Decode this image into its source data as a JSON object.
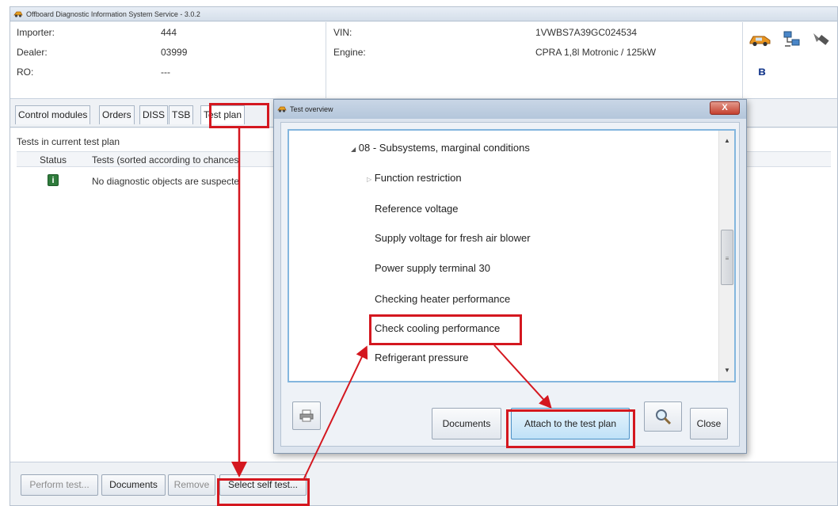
{
  "window": {
    "title": "Offboard Diagnostic Information System Service - 3.0.2"
  },
  "vehicle_info": {
    "importer_label": "Importer:",
    "importer_value": "444",
    "dealer_label": "Dealer:",
    "dealer_value": "03999",
    "ro_label": "RO:",
    "ro_value": "---",
    "vin_label": "VIN:",
    "vin_value": "1VWBS7A39GC024534",
    "engine_label": "Engine:",
    "engine_value": "CPRA 1,8l Motronic / 125kW"
  },
  "toolbar_icons": [
    "car-icon",
    "network-icon",
    "plug-icon",
    "bluetooth-icon"
  ],
  "tabs": [
    "Control modules",
    "Orders",
    "DISS",
    "TSB",
    "Test plan"
  ],
  "test_plan": {
    "list_title": "Tests in current test plan",
    "columns": [
      "Status",
      "Tests (sorted according to chances"
    ],
    "rows": [
      {
        "status_icon": "i",
        "text": "No diagnostic objects are suspecte"
      }
    ]
  },
  "bottom_buttons": {
    "perform_test": "Perform test...",
    "documents": "Documents",
    "remove": "Remove",
    "select_self_test": "Select self test..."
  },
  "dialog": {
    "title": "Test overview",
    "close_label": "X",
    "tree_items": [
      {
        "marker": "◢",
        "text": "08 - Subsystems, marginal conditions"
      },
      {
        "marker": "▷",
        "text": "Function restriction"
      },
      {
        "marker": "",
        "text": "Reference voltage"
      },
      {
        "marker": "",
        "text": "Supply voltage for fresh air blower"
      },
      {
        "marker": "",
        "text": "Power supply terminal 30"
      },
      {
        "marker": "",
        "text": "Checking heater performance"
      },
      {
        "marker": "",
        "text": "Check cooling performance"
      },
      {
        "marker": "",
        "text": "Refrigerant pressure"
      }
    ],
    "buttons": {
      "documents": "Documents",
      "attach": "Attach to the test plan",
      "close": "Close"
    }
  },
  "colors": {
    "highlight": "#d4171f",
    "tree_border": "#83b6de",
    "accent": "#2f7b3c"
  }
}
